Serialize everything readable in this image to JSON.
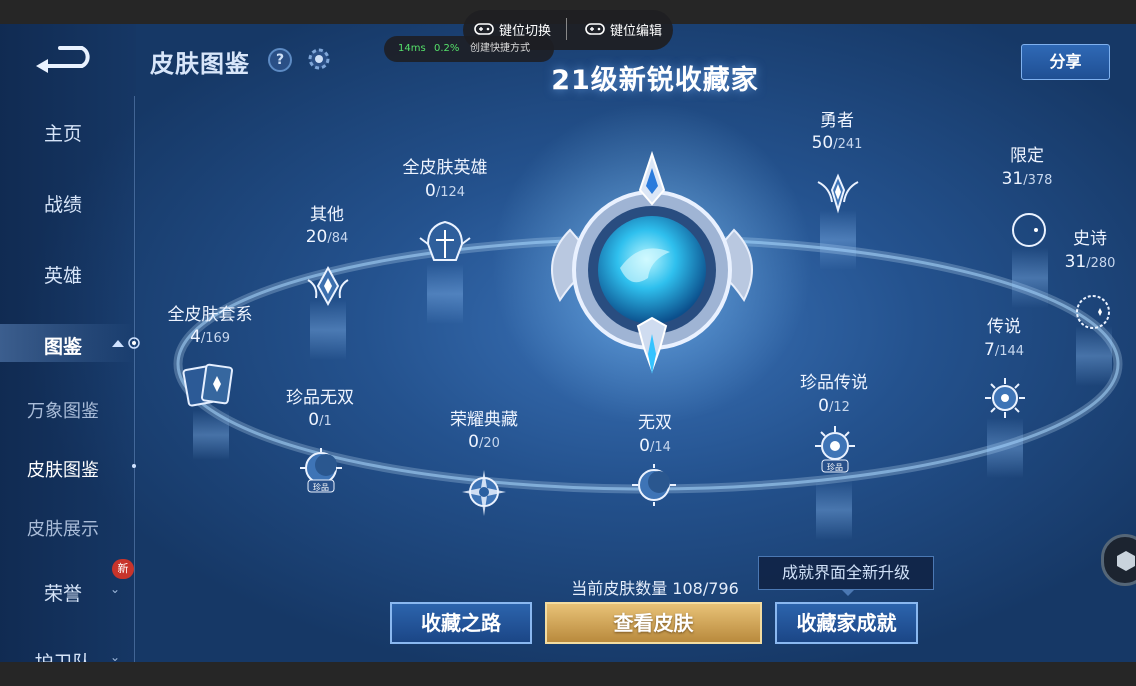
{
  "window": {
    "toolbar": {
      "key_switch": "键位切换",
      "key_edit": "键位编辑"
    },
    "perf": {
      "latency": "14ms",
      "loss": "0.2%",
      "shortcut": "创建快捷方式"
    }
  },
  "header": {
    "page_title": "皮肤图鉴",
    "help_symbol": "?",
    "main_title": "21级新锐收藏家",
    "share_label": "分享"
  },
  "sidebar": {
    "items": [
      {
        "label": "主页"
      },
      {
        "label": "战绩"
      },
      {
        "label": "英雄"
      },
      {
        "label": "图鉴",
        "active": true
      },
      {
        "label": "荣誉",
        "badge": "新"
      },
      {
        "label": "护卫队"
      }
    ],
    "sub_items": [
      {
        "label": "万象图鉴"
      },
      {
        "label": "皮肤图鉴",
        "active": true
      },
      {
        "label": "皮肤展示"
      }
    ]
  },
  "nodes": [
    {
      "label": "全皮肤套系",
      "count": "4",
      "total": "/169",
      "icon": "cards-icon"
    },
    {
      "label": "其他",
      "count": "20",
      "total": "/84",
      "icon": "diamond-emblem-icon"
    },
    {
      "label": "全皮肤英雄",
      "count": "0",
      "total": "/124",
      "icon": "helmet-emblem-icon"
    },
    {
      "label": "珍品无双",
      "count": "0",
      "total": "/1",
      "icon": "moon-emblem-icon"
    },
    {
      "label": "荣耀典藏",
      "count": "0",
      "total": "/20",
      "icon": "star-emblem-icon"
    },
    {
      "label": "无双",
      "count": "0",
      "total": "/14",
      "icon": "moon-emblem-icon"
    },
    {
      "label": "珍品传说",
      "count": "0",
      "total": "/12",
      "icon": "sun-emblem-icon"
    },
    {
      "label": "勇者",
      "count": "50",
      "total": "/241",
      "icon": "wing-emblem-icon"
    },
    {
      "label": "限定",
      "count": "31",
      "total": "/378",
      "icon": "crescent-emblem-icon"
    },
    {
      "label": "史诗",
      "count": "31",
      "total": "/280",
      "icon": "crescent-emblem-icon"
    },
    {
      "label": "传说",
      "count": "7",
      "total": "/144",
      "icon": "sun-emblem-icon"
    }
  ],
  "badge_tag": "珍品",
  "footer": {
    "skin_count": "当前皮肤数量 108/796",
    "notice": "成就界面全新升级",
    "btn_road": "收藏之路",
    "btn_view": "查看皮肤",
    "btn_achieve": "收藏家成就"
  },
  "colors": {
    "accent_gold": "#d8aa5a",
    "accent_blue": "#2c64ad",
    "badge_red": "#c8342b"
  }
}
